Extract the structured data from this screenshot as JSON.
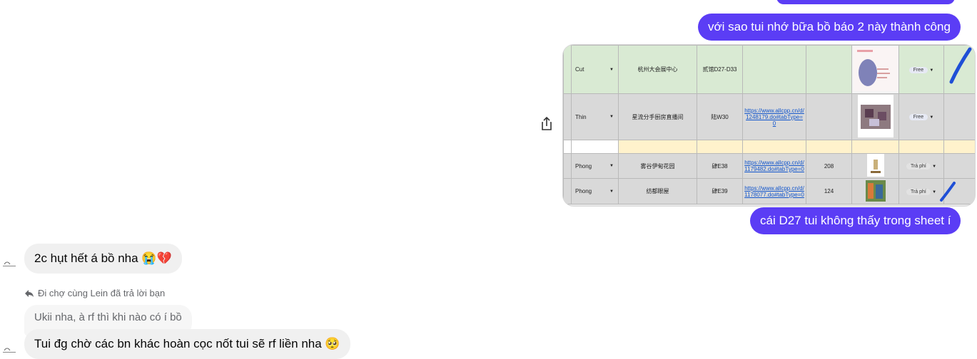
{
  "messages": {
    "sent_1": "với sao tui nhớ bữa bồ báo 2 này thành công",
    "sent_2": "cái D27 tui không thấy trong sheet í",
    "received_1": "2c hụt hết á bồ nha 😭💔",
    "reply_note": "Đi chợ cùng Lein đã trả lời bạn",
    "reply_preview": "Ukii nha, à rf thì khi nào có í bồ",
    "received_2": "Tui đg chờ các bn khác hoàn cọc nốt tui sẽ rf liền nha 🥺"
  },
  "sheet": {
    "rows": [
      {
        "name": "Cut",
        "shop": "杭州大会展中心",
        "booth": "贰馆D27-D33",
        "link": "",
        "qty": "",
        "status": "Free",
        "style": "green"
      },
      {
        "name": "Thin",
        "shop": "星流分手厨房直播间",
        "booth": "陆W30",
        "link": "https://www.allcpp.cn/d/1248179.do#tabType=0",
        "qty": "",
        "status": "Free",
        "style": "gray"
      },
      {
        "name": "",
        "shop": "",
        "booth": "",
        "link": "",
        "qty": "",
        "status": "",
        "style": "yellow"
      },
      {
        "name": "Phong",
        "shop": "雾谷伊甸花园",
        "booth": "肆E38",
        "link": "https://www.allcpp.cn/d/1179482.do#tabType=0",
        "qty": "208",
        "status": "Trả phí",
        "style": "gray"
      },
      {
        "name": "Phong",
        "shop": "纺都眼屋",
        "booth": "肆E39",
        "link": "https://www.allcpp.cn/d/1178077.do#tabType=0",
        "qty": "124",
        "status": "Trả phí",
        "style": "gray"
      }
    ]
  },
  "colors": {
    "sent_bubble": "#5b3df5",
    "received_bubble": "#f0f0f0",
    "check_mark": "#1f4fd6"
  }
}
